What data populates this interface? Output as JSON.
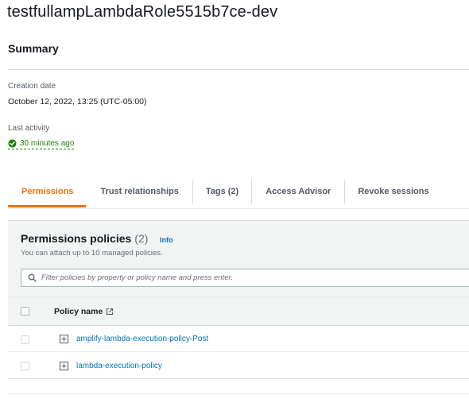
{
  "role": {
    "title": "testfullampLambdaRole5515b7ce-dev"
  },
  "summary": {
    "heading": "Summary",
    "creation_label": "Creation date",
    "creation_value": "October 12, 2022, 13:25 (UTC-05:00)",
    "activity_label": "Last activity",
    "activity_value": "30 minutes ago",
    "activity_icon": "check-circle-icon",
    "status_color": "#1d8102"
  },
  "tabs": [
    {
      "label": "Permissions",
      "active": true
    },
    {
      "label": "Trust relationships",
      "active": false
    },
    {
      "label": "Tags (2)",
      "active": false
    },
    {
      "label": "Access Advisor",
      "active": false
    },
    {
      "label": "Revoke sessions",
      "active": false
    }
  ],
  "accent_color": "#ec7211",
  "permissions": {
    "title": "Permissions policies",
    "count": "(2)",
    "info_label": "Info",
    "description": "You can attach up to 10 managed policies.",
    "search_placeholder": "Filter policies by property or policy name and press enter.",
    "column_header": "Policy name",
    "policies": [
      {
        "name": "amplify-lambda-execution-policy-Post"
      },
      {
        "name": "lambda-execution-policy"
      }
    ]
  }
}
